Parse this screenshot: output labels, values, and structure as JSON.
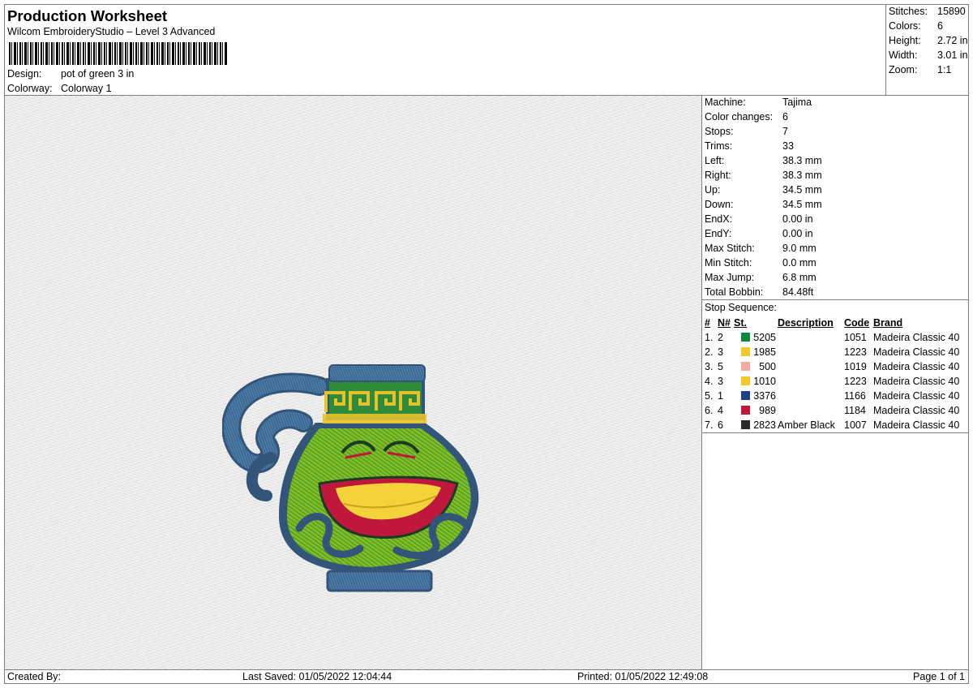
{
  "header": {
    "title": "Production Worksheet",
    "software": "Wilcom EmbroideryStudio – Level 3 Advanced",
    "design_label": "Design:",
    "design_value": "pot of green 3 in",
    "colorway_label": "Colorway:",
    "colorway_value": "Colorway 1"
  },
  "stats": [
    {
      "label": "Stitches:",
      "value": "15890"
    },
    {
      "label": "Colors:",
      "value": "6"
    },
    {
      "label": "Height:",
      "value": "2.72 in"
    },
    {
      "label": "Width:",
      "value": "3.01 in"
    },
    {
      "label": "Zoom:",
      "value": "1:1"
    }
  ],
  "machine": [
    {
      "label": "Machine:",
      "value": "Tajima"
    },
    {
      "label": "Color changes:",
      "value": "6"
    },
    {
      "label": "Stops:",
      "value": "7"
    },
    {
      "label": "Trims:",
      "value": "33"
    },
    {
      "label": "Left:",
      "value": "38.3 mm"
    },
    {
      "label": "Right:",
      "value": "38.3 mm"
    },
    {
      "label": "Up:",
      "value": "34.5 mm"
    },
    {
      "label": "Down:",
      "value": "34.5 mm"
    },
    {
      "label": "EndX:",
      "value": "0.00 in"
    },
    {
      "label": "EndY:",
      "value": "0.00 in"
    },
    {
      "label": "Max Stitch:",
      "value": "9.0 mm"
    },
    {
      "label": "Min Stitch:",
      "value": "0.0 mm"
    },
    {
      "label": "Max Jump:",
      "value": "6.8 mm"
    },
    {
      "label": "Total Bobbin:",
      "value": "84.48ft"
    }
  ],
  "stop_sequence": {
    "heading": "Stop Sequence:",
    "columns": {
      "num": "#",
      "n": "N#",
      "st": "St.",
      "description": "Description",
      "code": "Code",
      "brand": "Brand"
    },
    "rows": [
      {
        "num": "1.",
        "n": "2",
        "color": "#0a8a3c",
        "st": "5205",
        "description": "",
        "code": "1051",
        "brand": "Madeira Classic 40"
      },
      {
        "num": "2.",
        "n": "3",
        "color": "#f3c92a",
        "st": "1985",
        "description": "",
        "code": "1223",
        "brand": "Madeira Classic 40"
      },
      {
        "num": "3.",
        "n": "5",
        "color": "#f2aba0",
        "st": "500",
        "description": "",
        "code": "1019",
        "brand": "Madeira Classic 40"
      },
      {
        "num": "4.",
        "n": "3",
        "color": "#f3c92a",
        "st": "1010",
        "description": "",
        "code": "1223",
        "brand": "Madeira Classic 40"
      },
      {
        "num": "5.",
        "n": "1",
        "color": "#1f3f8a",
        "st": "3376",
        "description": "",
        "code": "1166",
        "brand": "Madeira Classic 40"
      },
      {
        "num": "6.",
        "n": "4",
        "color": "#c0183c",
        "st": "989",
        "description": "",
        "code": "1184",
        "brand": "Madeira Classic 40"
      },
      {
        "num": "7.",
        "n": "6",
        "color": "#2a2a2a",
        "st": "2823",
        "description": "Amber Black",
        "code": "1007",
        "brand": "Madeira Classic 40"
      }
    ]
  },
  "footer": {
    "created_by": "Created By:",
    "last_saved": "Last Saved: 01/05/2022 12:04:44",
    "printed": "Printed: 01/05/2022 12:49:08",
    "page": "Page 1 of 1"
  }
}
